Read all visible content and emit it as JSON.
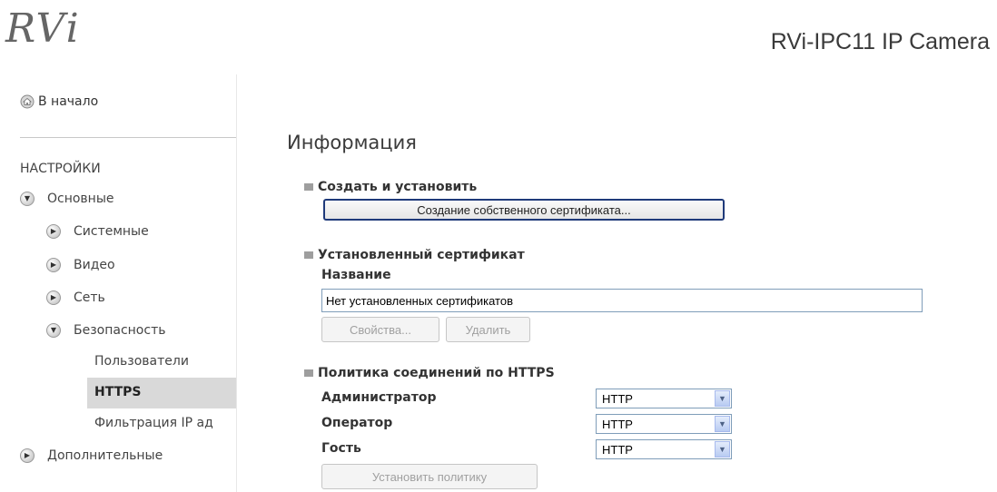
{
  "header": {
    "logo": "RVi",
    "camera_title": "RVi-IPC11 IP Camera"
  },
  "sidebar": {
    "home_label": "В начало",
    "settings_heading": "НАСТРОЙКИ",
    "items": [
      {
        "label": "Основные",
        "expanded": true
      },
      {
        "label": "Системные",
        "expanded": false
      },
      {
        "label": "Видео",
        "expanded": false
      },
      {
        "label": "Сеть",
        "expanded": false
      },
      {
        "label": "Безопасность",
        "expanded": true
      },
      {
        "label": "Дополнительные",
        "expanded": false
      }
    ],
    "sub_items": [
      "Пользователи",
      "HTTPS",
      "Фильтрация IP ад"
    ],
    "active_sub_item": "HTTPS"
  },
  "main": {
    "title": "Информация",
    "create_section": {
      "title": "Создать и установить",
      "button": "Создание собственного сертификата..."
    },
    "installed_section": {
      "title": "Установленный сертификат",
      "name_label": "Название",
      "name_value": "Нет установленных сертификатов",
      "properties_button": "Свойства...",
      "delete_button": "Удалить"
    },
    "policy_section": {
      "title": "Политика соединений по HTTPS",
      "rows": [
        {
          "label": "Администратор",
          "value": "HTTP"
        },
        {
          "label": "Оператор",
          "value": "HTTP"
        },
        {
          "label": "Гость",
          "value": "HTTP"
        }
      ],
      "apply_button": "Установить политику"
    }
  },
  "icons": {
    "home": "home-icon",
    "expanded_arrow": "chevron-down-icon",
    "collapsed_arrow": "chevron-right-icon",
    "dropdown": "dropdown-arrow-icon"
  }
}
